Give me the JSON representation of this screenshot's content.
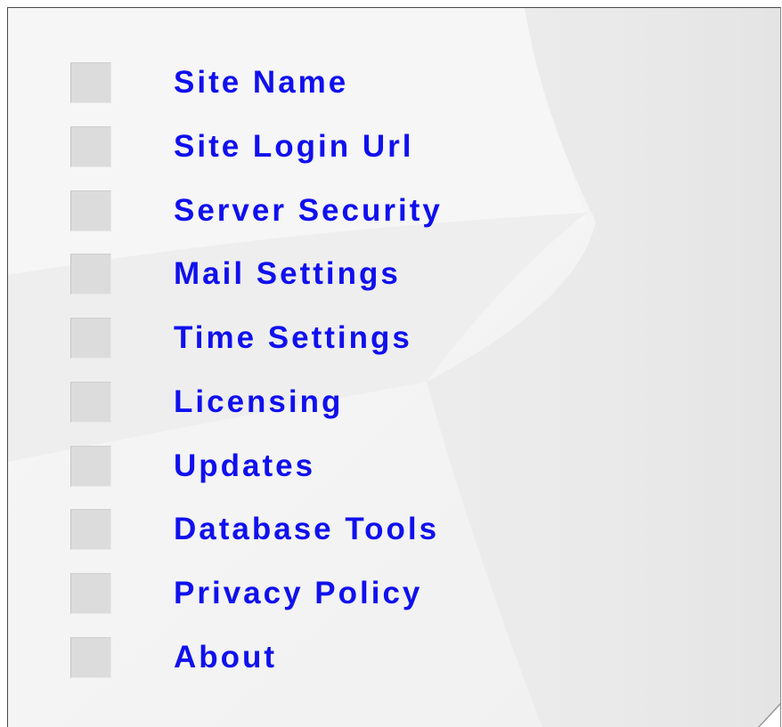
{
  "colors": {
    "link_text": "#1010ee",
    "checkbox_fill": "#dcdcdc",
    "panel_background": "#f4f4f4",
    "panel_border": "#4a4a4a"
  },
  "menu": {
    "items": [
      {
        "label": "Site Name",
        "checked": false
      },
      {
        "label": "Site Login Url",
        "checked": false
      },
      {
        "label": "Server Security",
        "checked": false
      },
      {
        "label": "Mail Settings",
        "checked": false
      },
      {
        "label": "Time Settings",
        "checked": false
      },
      {
        "label": "Licensing",
        "checked": false
      },
      {
        "label": "Updates",
        "checked": false
      },
      {
        "label": "Database Tools",
        "checked": false
      },
      {
        "label": "Privacy Policy",
        "checked": false
      },
      {
        "label": "About",
        "checked": false
      }
    ]
  }
}
